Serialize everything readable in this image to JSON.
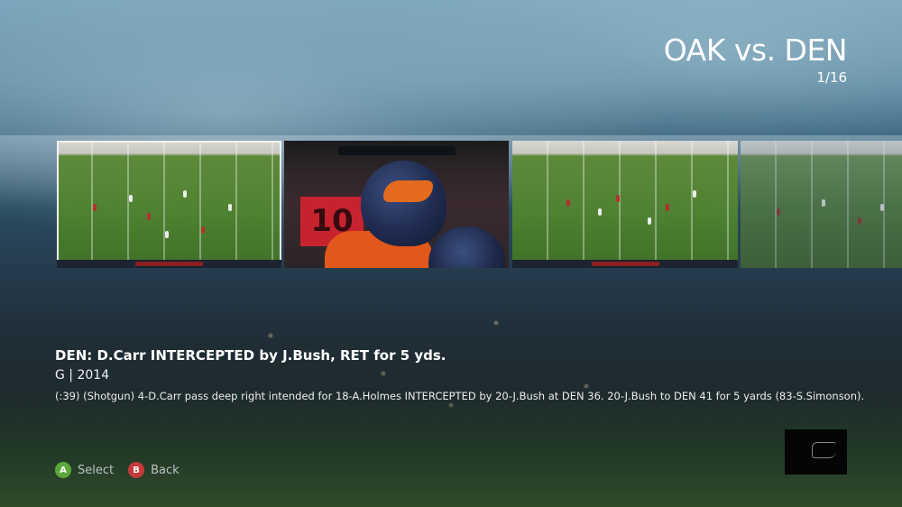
{
  "header": {
    "title": "OAK vs. DEN",
    "page_counter": "1/16"
  },
  "carousel": {
    "thumbnails": [
      {
        "kind": "field-play",
        "selected": true
      },
      {
        "kind": "player-closeup",
        "jersey_number": "10",
        "selected": false
      },
      {
        "kind": "field-play",
        "selected": false
      },
      {
        "kind": "field-play",
        "selected": false
      }
    ]
  },
  "play": {
    "headline": "DEN: D.Carr INTERCEPTED by J.Bush, RET for 5 yds.",
    "meta": "G | 2014",
    "description": "(:39) (Shotgun) 4-D.Carr pass deep right intended for 18-A.Holmes INTERCEPTED by 20-J.Bush at DEN 36. 20-J.Bush to DEN 41 for 5 yards (83-S.Simonson)."
  },
  "controls": {
    "a_glyph": "A",
    "select_label": "Select",
    "b_glyph": "B",
    "back_label": "Back"
  },
  "colors": {
    "select_button": "#5aa83b",
    "back_button": "#c53a3a",
    "broncos_orange": "#e2571a",
    "broncos_navy": "#1f2b4f"
  }
}
